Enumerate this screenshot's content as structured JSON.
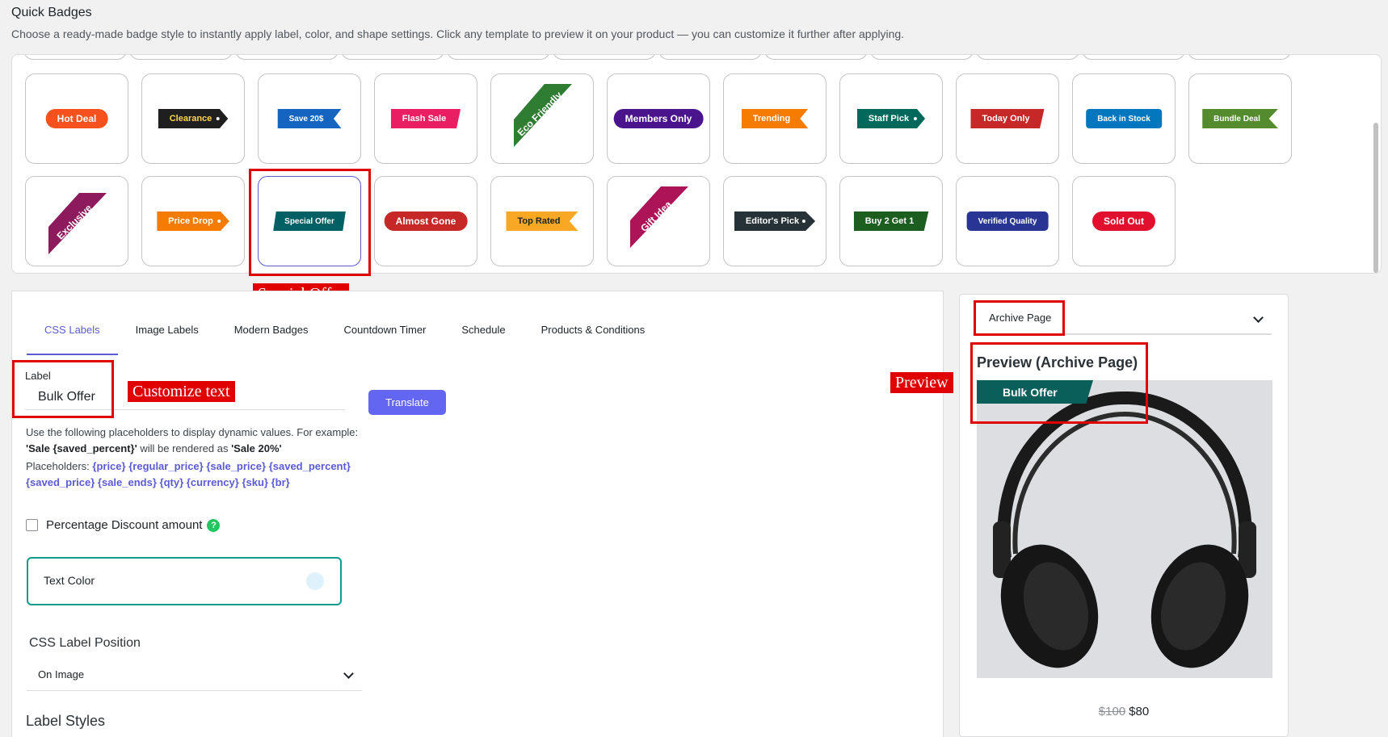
{
  "header": {
    "title": "Quick Badges",
    "description": "Choose a ready-made badge style to instantly apply label, color, and shape settings. Click any template to preview it on your product — you can customize it further after applying."
  },
  "templates": {
    "row1": [
      {
        "label": "Hot Deal",
        "color": "#f4511e",
        "shape": "pill"
      },
      {
        "label": "Clearance",
        "color": "#1f1f1f",
        "text_color": "#ffd54f",
        "shape": "tag-arrow"
      },
      {
        "label": "Save 20$",
        "color": "#1565c0",
        "shape": "flag"
      },
      {
        "label": "Flash Sale",
        "color": "#e91e63",
        "shape": "slant"
      },
      {
        "label": "Eco Friendly",
        "color": "#2e7d32",
        "shape": "ribbon"
      },
      {
        "label": "Members Only",
        "color": "#4a148c",
        "shape": "pill"
      },
      {
        "label": "Trending",
        "color": "#f57c00",
        "shape": "flag"
      },
      {
        "label": "Staff Pick",
        "color": "#00695c",
        "shape": "tag-arrow"
      },
      {
        "label": "Today Only",
        "color": "#c62828",
        "shape": "slant"
      },
      {
        "label": "Back in Stock",
        "color": "#0277bd",
        "shape": "rounded"
      },
      {
        "label": "Bundle Deal",
        "color": "#558b2f",
        "shape": "flag"
      }
    ],
    "row2": [
      {
        "label": "Exclusive",
        "color": "#8e1a5e",
        "shape": "ribbon"
      },
      {
        "label": "Price Drop",
        "color": "#f57c00",
        "shape": "tag-arrow"
      },
      {
        "label": "Special Offer",
        "color": "#006064",
        "shape": "slant2"
      },
      {
        "label": "Almost Gone",
        "color": "#c62828",
        "shape": "pill"
      },
      {
        "label": "Top Rated",
        "color": "#f9a825",
        "text_color": "#1d2327",
        "shape": "flag"
      },
      {
        "label": "Gift Idea",
        "color": "#ad1457",
        "shape": "ribbon"
      },
      {
        "label": "Editor's Pick",
        "color": "#263238",
        "shape": "tag-arrow"
      },
      {
        "label": "Buy 2 Get 1",
        "color": "#1b5e20",
        "shape": "slant"
      },
      {
        "label": "Verified Quality",
        "color": "#283593",
        "shape": "rounded"
      },
      {
        "label": "Sold Out",
        "color": "#e0102e",
        "shape": "pill"
      }
    ],
    "selected": "Special Offer"
  },
  "annotations": {
    "special_offer": "Special Offer",
    "customize_text": "Customize text",
    "preview": "Preview"
  },
  "tabs": [
    "CSS Labels",
    "Image Labels",
    "Modern Badges",
    "Countdown Timer",
    "Schedule",
    "Products & Conditions"
  ],
  "label_field": {
    "label": "Label",
    "value": "Bulk Offer",
    "translate_button": "Translate"
  },
  "help": {
    "line1_prefix": "Use the following placeholders to display dynamic values. For example:",
    "example_in": "'Sale {saved_percent}'",
    "will_be": " will be rendered as ",
    "example_out": "'Sale 20%'",
    "placeholders_label": "Placeholders: ",
    "placeholders": [
      "{price}",
      "{regular_price}",
      "{sale_price}",
      "{saved_percent}",
      "{saved_price}",
      "{sale_ends}",
      "{qty}",
      "{currency}",
      "{sku}",
      "{br}"
    ]
  },
  "percentage_discount": {
    "label": "Percentage Discount amount",
    "help_icon": "?",
    "checked": false
  },
  "text_color": {
    "label": "Text Color",
    "value": "#dff2fb"
  },
  "position": {
    "title": "CSS Label Position",
    "value": "On Image"
  },
  "label_styles": {
    "title": "Label Styles"
  },
  "preview": {
    "page_select": "Archive Page",
    "title": "Preview (Archive Page)",
    "badge_text": "Bulk Offer",
    "badge_color": "#0b5f5a",
    "old_price": "$100",
    "new_price": "$80"
  },
  "colors": {
    "accent": "#5b5bd6",
    "annotation_red": "#e00000"
  }
}
